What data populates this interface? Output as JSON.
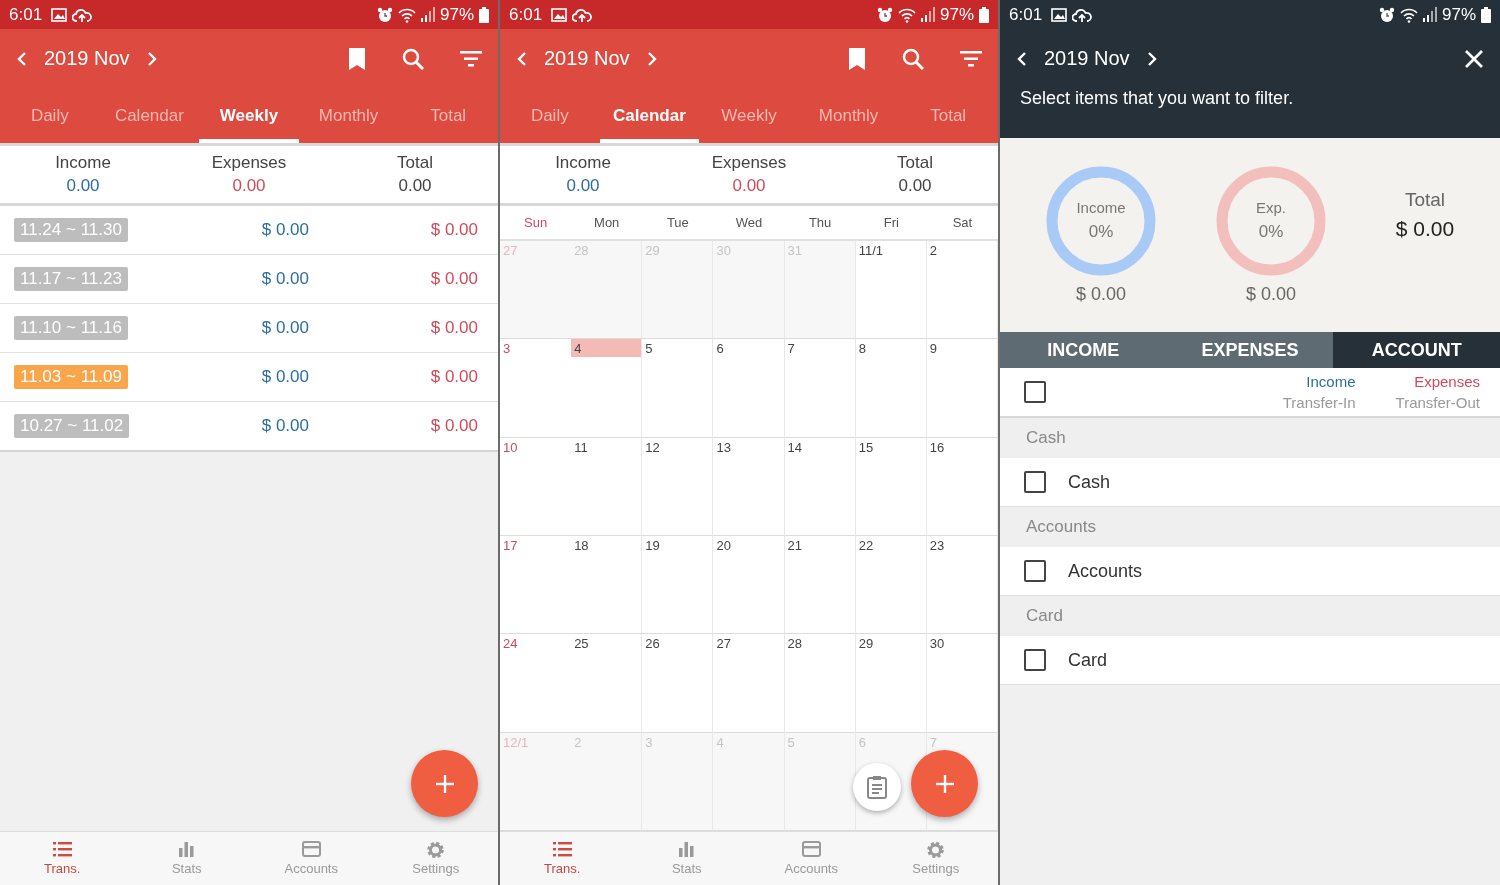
{
  "screens": [
    {
      "kind": "weekly",
      "status_bar": {
        "time": "6:01",
        "battery": "97%"
      },
      "header": {
        "month": "2019 Nov"
      },
      "tabs": [
        {
          "label": "Daily",
          "selected": false
        },
        {
          "label": "Calendar",
          "selected": false
        },
        {
          "label": "Weekly",
          "selected": true
        },
        {
          "label": "Monthly",
          "selected": false
        },
        {
          "label": "Total",
          "selected": false
        }
      ],
      "summary": [
        {
          "label": "Income",
          "value": "0.00",
          "kind": "income"
        },
        {
          "label": "Expenses",
          "value": "0.00",
          "kind": "expense"
        },
        {
          "label": "Total",
          "value": "0.00",
          "kind": "total"
        }
      ],
      "weeks": [
        {
          "range": "11.24 ~ 11.30",
          "income": "$ 0.00",
          "expense": "$ 0.00",
          "selected": false
        },
        {
          "range": "11.17 ~ 11.23",
          "income": "$ 0.00",
          "expense": "$ 0.00",
          "selected": false
        },
        {
          "range": "11.10 ~ 11.16",
          "income": "$ 0.00",
          "expense": "$ 0.00",
          "selected": false
        },
        {
          "range": "11.03 ~ 11.09",
          "income": "$ 0.00",
          "expense": "$ 0.00",
          "selected": true
        },
        {
          "range": "10.27 ~ 11.02",
          "income": "$ 0.00",
          "expense": "$ 0.00",
          "selected": false
        }
      ],
      "bottom_nav": [
        {
          "label": "Trans.",
          "selected": true
        },
        {
          "label": "Stats",
          "selected": false
        },
        {
          "label": "Accounts",
          "selected": false
        },
        {
          "label": "Settings",
          "selected": false
        }
      ]
    },
    {
      "kind": "calendar",
      "status_bar": {
        "time": "6:01",
        "battery": "97%"
      },
      "header": {
        "month": "2019 Nov"
      },
      "tabs": [
        {
          "label": "Daily",
          "selected": false
        },
        {
          "label": "Calendar",
          "selected": true
        },
        {
          "label": "Weekly",
          "selected": false
        },
        {
          "label": "Monthly",
          "selected": false
        },
        {
          "label": "Total",
          "selected": false
        }
      ],
      "summary": [
        {
          "label": "Income",
          "value": "0.00",
          "kind": "income"
        },
        {
          "label": "Expenses",
          "value": "0.00",
          "kind": "expense"
        },
        {
          "label": "Total",
          "value": "0.00",
          "kind": "total"
        }
      ],
      "weekdays": [
        "Sun",
        "Mon",
        "Tue",
        "Wed",
        "Thu",
        "Fri",
        "Sat"
      ],
      "days": [
        {
          "label": "27",
          "in_month": false,
          "today": false
        },
        {
          "label": "28",
          "in_month": false,
          "today": false
        },
        {
          "label": "29",
          "in_month": false,
          "today": false
        },
        {
          "label": "30",
          "in_month": false,
          "today": false
        },
        {
          "label": "31",
          "in_month": false,
          "today": false
        },
        {
          "label": "11/1",
          "in_month": true,
          "today": false
        },
        {
          "label": "2",
          "in_month": true,
          "today": false
        },
        {
          "label": "3",
          "in_month": true,
          "today": false
        },
        {
          "label": "4",
          "in_month": true,
          "today": true
        },
        {
          "label": "5",
          "in_month": true,
          "today": false
        },
        {
          "label": "6",
          "in_month": true,
          "today": false
        },
        {
          "label": "7",
          "in_month": true,
          "today": false
        },
        {
          "label": "8",
          "in_month": true,
          "today": false
        },
        {
          "label": "9",
          "in_month": true,
          "today": false
        },
        {
          "label": "10",
          "in_month": true,
          "today": false
        },
        {
          "label": "11",
          "in_month": true,
          "today": false
        },
        {
          "label": "12",
          "in_month": true,
          "today": false
        },
        {
          "label": "13",
          "in_month": true,
          "today": false
        },
        {
          "label": "14",
          "in_month": true,
          "today": false
        },
        {
          "label": "15",
          "in_month": true,
          "today": false
        },
        {
          "label": "16",
          "in_month": true,
          "today": false
        },
        {
          "label": "17",
          "in_month": true,
          "today": false
        },
        {
          "label": "18",
          "in_month": true,
          "today": false
        },
        {
          "label": "19",
          "in_month": true,
          "today": false
        },
        {
          "label": "20",
          "in_month": true,
          "today": false
        },
        {
          "label": "21",
          "in_month": true,
          "today": false
        },
        {
          "label": "22",
          "in_month": true,
          "today": false
        },
        {
          "label": "23",
          "in_month": true,
          "today": false
        },
        {
          "label": "24",
          "in_month": true,
          "today": false
        },
        {
          "label": "25",
          "in_month": true,
          "today": false
        },
        {
          "label": "26",
          "in_month": true,
          "today": false
        },
        {
          "label": "27",
          "in_month": true,
          "today": false
        },
        {
          "label": "28",
          "in_month": true,
          "today": false
        },
        {
          "label": "29",
          "in_month": true,
          "today": false
        },
        {
          "label": "30",
          "in_month": true,
          "today": false
        },
        {
          "label": "12/1",
          "in_month": false,
          "today": false
        },
        {
          "label": "2",
          "in_month": false,
          "today": false
        },
        {
          "label": "3",
          "in_month": false,
          "today": false
        },
        {
          "label": "4",
          "in_month": false,
          "today": false
        },
        {
          "label": "5",
          "in_month": false,
          "today": false
        },
        {
          "label": "6",
          "in_month": false,
          "today": false
        },
        {
          "label": "7",
          "in_month": false,
          "today": false
        }
      ],
      "bottom_nav": [
        {
          "label": "Trans.",
          "selected": true
        },
        {
          "label": "Stats",
          "selected": false
        },
        {
          "label": "Accounts",
          "selected": false
        },
        {
          "label": "Settings",
          "selected": false
        }
      ]
    },
    {
      "kind": "filter",
      "status_bar": {
        "time": "6:01",
        "battery": "97%"
      },
      "header": {
        "month": "2019 Nov"
      },
      "message": "Select items that you want to filter.",
      "rings": [
        {
          "label": "Income",
          "percent": "0%",
          "amount": "$ 0.00",
          "kind": "income"
        },
        {
          "label": "Exp.",
          "percent": "0%",
          "amount": "$ 0.00",
          "kind": "expense"
        }
      ],
      "total": {
        "label": "Total",
        "value": "$ 0.00"
      },
      "filter_tabs": [
        {
          "label": "INCOME",
          "selected": false
        },
        {
          "label": "EXPENSES",
          "selected": false
        },
        {
          "label": "ACCOUNT",
          "selected": true
        }
      ],
      "select_all": {
        "checked": false
      },
      "columns": [
        {
          "title": "Income",
          "subtitle": "Transfer-In",
          "kind": "income"
        },
        {
          "title": "Expenses",
          "subtitle": "Transfer-Out",
          "kind": "expense"
        }
      ],
      "groups": [
        {
          "title": "Cash",
          "items": [
            {
              "label": "Cash",
              "checked": false
            }
          ]
        },
        {
          "title": "Accounts",
          "items": [
            {
              "label": "Accounts",
              "checked": false
            }
          ]
        },
        {
          "title": "Card",
          "items": [
            {
              "label": "Card",
              "checked": false
            }
          ]
        }
      ]
    }
  ]
}
